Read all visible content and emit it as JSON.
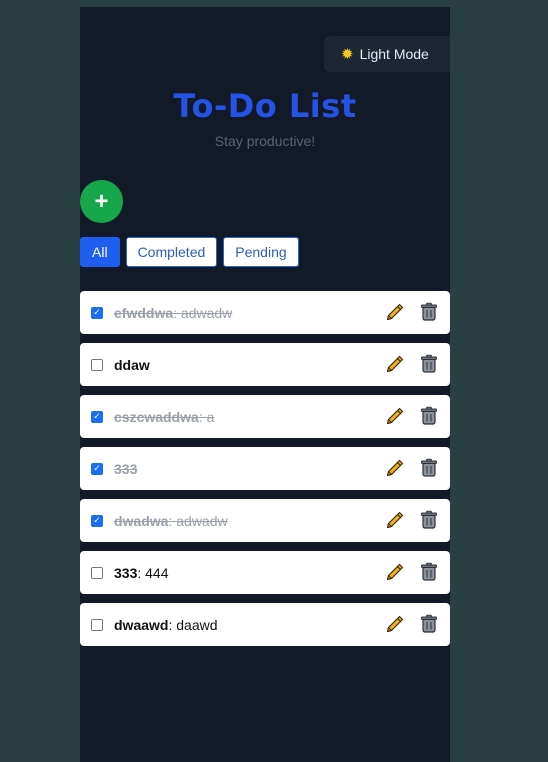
{
  "theme_toggle": {
    "icon": "sun-icon",
    "label": "Light Mode"
  },
  "header": {
    "title": "To-Do List",
    "subtitle": "Stay productive!"
  },
  "add_button": {
    "label": "+"
  },
  "filters": [
    {
      "label": "All",
      "active": true
    },
    {
      "label": "Completed",
      "active": false
    },
    {
      "label": "Pending",
      "active": false
    }
  ],
  "tasks": [
    {
      "title": "efwddwa",
      "sep": ": ",
      "description": "adwadw",
      "completed": true
    },
    {
      "title": "ddaw",
      "sep": "",
      "description": "",
      "completed": false
    },
    {
      "title": "cszcwaddwa",
      "sep": ": ",
      "description": "a",
      "completed": true
    },
    {
      "title": "333",
      "sep": "",
      "description": "",
      "completed": true
    },
    {
      "title": "dwadwa",
      "sep": ": ",
      "description": "adwadw",
      "completed": true
    },
    {
      "title": "333",
      "sep": ": ",
      "description": "444",
      "completed": false
    },
    {
      "title": "dwaawd",
      "sep": ": ",
      "description": "daawd",
      "completed": false
    }
  ],
  "colors": {
    "accent": "#2453e6",
    "add": "#17a74a",
    "check": "#1a6ff2",
    "pencil": "#f2b01d"
  }
}
